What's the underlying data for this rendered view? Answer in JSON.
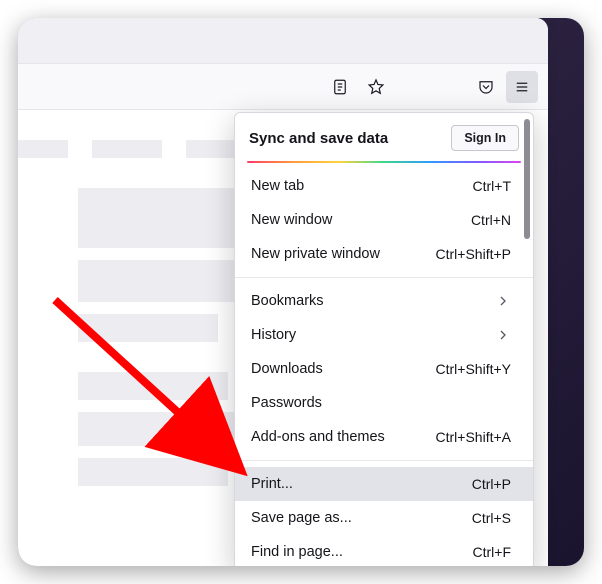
{
  "menu": {
    "sync_title": "Sync and save data",
    "sign_in_label": "Sign In",
    "items": [
      {
        "label": "New tab",
        "shortcut": "Ctrl+T"
      },
      {
        "label": "New window",
        "shortcut": "Ctrl+N"
      },
      {
        "label": "New private window",
        "shortcut": "Ctrl+Shift+P"
      }
    ],
    "nav": [
      {
        "label": "Bookmarks"
      },
      {
        "label": "History"
      },
      {
        "label": "Downloads",
        "shortcut": "Ctrl+Shift+Y"
      },
      {
        "label": "Passwords"
      },
      {
        "label": "Add-ons and themes",
        "shortcut": "Ctrl+Shift+A"
      }
    ],
    "page_actions": [
      {
        "label": "Print...",
        "shortcut": "Ctrl+P"
      },
      {
        "label": "Save page as...",
        "shortcut": "Ctrl+S"
      },
      {
        "label": "Find in page...",
        "shortcut": "Ctrl+F"
      }
    ]
  }
}
